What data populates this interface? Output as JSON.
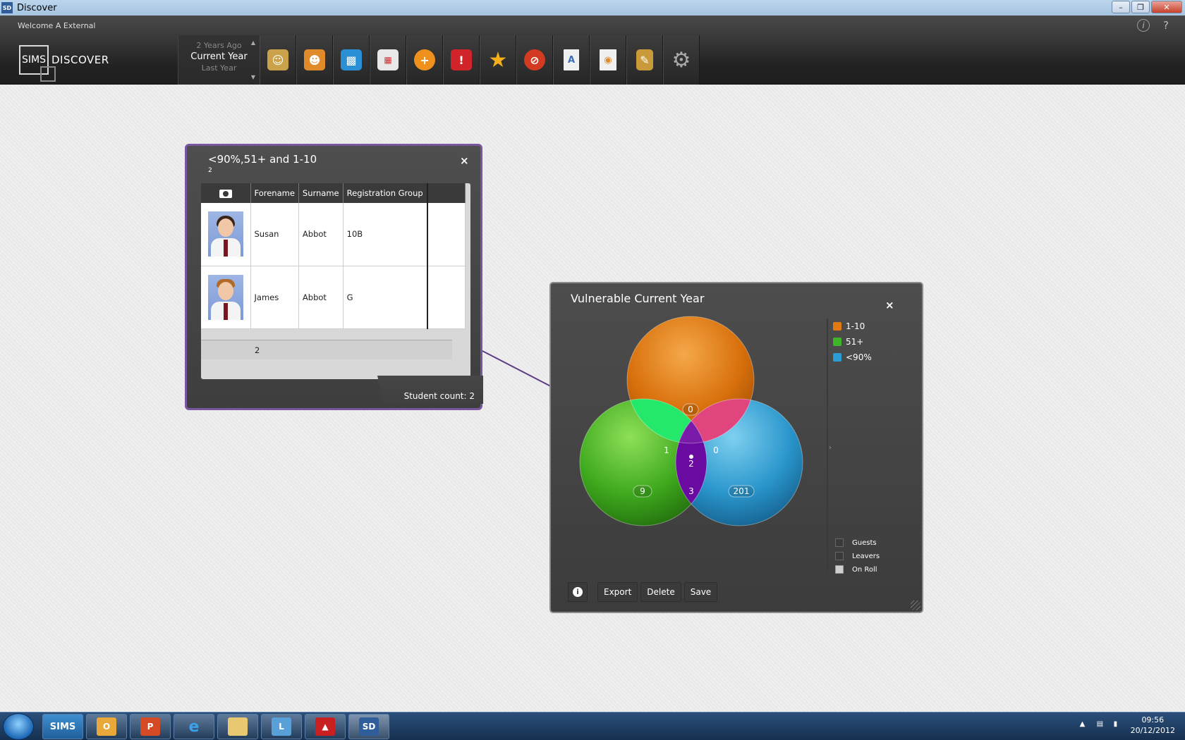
{
  "window": {
    "title": "Discover",
    "app_icon": "SD",
    "buttons": [
      "minimize",
      "maximize",
      "close"
    ]
  },
  "welcome": {
    "text": "Welcome A External",
    "info_icon": "info-icon",
    "help_icon": "help-icon",
    "help_label": "?"
  },
  "toolbar": {
    "logo_box": "SIMS",
    "logo_text": "DISCOVER",
    "year_options": [
      "2 Years Ago",
      "Current Year",
      "Last Year"
    ],
    "tools": [
      {
        "icon": "student-contacts-icon",
        "color": "#c9a24a"
      },
      {
        "icon": "staff-contacts-icon",
        "color": "#e08a2a"
      },
      {
        "icon": "groups-icon",
        "color": "#2a8fd4"
      },
      {
        "icon": "calendar-icon",
        "color": "#d8d8d8"
      },
      {
        "icon": "add-icon",
        "color": "#f0901c"
      },
      {
        "icon": "alert-icon",
        "color": "#d0242a"
      },
      {
        "icon": "star-icon",
        "color": "#f4b01a"
      },
      {
        "icon": "no-entry-icon",
        "color": "#d33a22"
      },
      {
        "icon": "assessment-icon",
        "color": "#f0f0f0"
      },
      {
        "icon": "report-icon",
        "color": "#f0f0f0"
      },
      {
        "icon": "notebook-icon",
        "color": "#c99a3a"
      },
      {
        "icon": "settings-icon",
        "color": "#aaaaaa"
      }
    ]
  },
  "student_list": {
    "title": "<90%,51+ and 1-10",
    "subtitle": "2",
    "columns": [
      "Forename",
      "Surname",
      "Registration Group"
    ],
    "photo_column_icon": "camera-icon",
    "rows": [
      {
        "forename": "Susan",
        "surname": "Abbot",
        "reg_group": "10B"
      },
      {
        "forename": "James",
        "surname": "Abbot",
        "reg_group": "G"
      }
    ],
    "total": "2",
    "student_count": "Student count: 2",
    "close_label": "×"
  },
  "venn": {
    "title": "Vulnerable Current Year",
    "close_label": "×",
    "legend": [
      {
        "label": "1-10",
        "color": "#e07a10"
      },
      {
        "label": "51+",
        "color": "#3fb52a"
      },
      {
        "label": "<90%",
        "color": "#2a9ed4"
      }
    ],
    "regions": {
      "only_1_10": "0",
      "only_51": "9",
      "only_90": "201",
      "1_10_and_51": "1",
      "1_10_and_90": "0",
      "51_and_90": "3",
      "all_three": "2"
    },
    "filters": [
      {
        "label": "Guests",
        "checked": false
      },
      {
        "label": "Leavers",
        "checked": false
      },
      {
        "label": "On Roll",
        "checked": true
      }
    ],
    "buttons": {
      "info": "i",
      "export": "Export",
      "delete": "Delete",
      "save": "Save"
    }
  },
  "taskbar": {
    "items": [
      "SIMS",
      "outlook",
      "powerpoint",
      "internet-explorer",
      "explorer",
      "lync",
      "remote",
      "SD"
    ],
    "sims_label": "SIMS",
    "sd_label": "SD",
    "time": "09:56",
    "date": "20/12/2012"
  }
}
